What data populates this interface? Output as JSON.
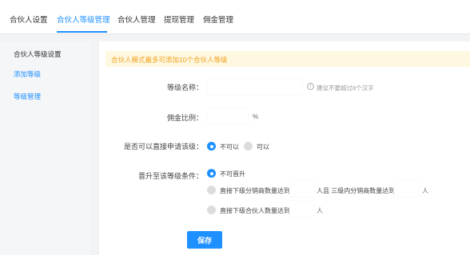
{
  "tabs": [
    {
      "label": "合伙人设置"
    },
    {
      "label": "合伙人等级管理",
      "active": true
    },
    {
      "label": "合伙人管理"
    },
    {
      "label": "提现管理"
    },
    {
      "label": "佣金管理"
    }
  ],
  "sidebar": {
    "title": "合伙人等级设置",
    "items": [
      {
        "label": "添加等级"
      },
      {
        "label": "等级管理"
      }
    ]
  },
  "notice": "合伙人模式最多可添加10个合伙人等级",
  "form": {
    "level_name": {
      "label": "等级名称：",
      "value": "",
      "hint_icon": "info-icon",
      "hint": "建议不要超过8个汉字"
    },
    "commission": {
      "label": "佣金比例：",
      "value": "",
      "unit": "%"
    },
    "direct_apply": {
      "label": "是否可以直接申请该级：",
      "options": [
        "不可以",
        "可以"
      ],
      "selected": 0
    },
    "upgrade": {
      "label": "晋升至该等级条件：",
      "options": [
        "不可晋升",
        "直接下级分销商数量达到",
        "直接下级合伙人数量达到"
      ],
      "selected": 0,
      "opt1_mid": "人且 三级内分销商数量达到",
      "unit": "人"
    }
  },
  "save_label": "保存",
  "colors": {
    "accent": "#1e90ff",
    "notice_bg": "#fff8e1",
    "notice_text": "#f0a020"
  }
}
